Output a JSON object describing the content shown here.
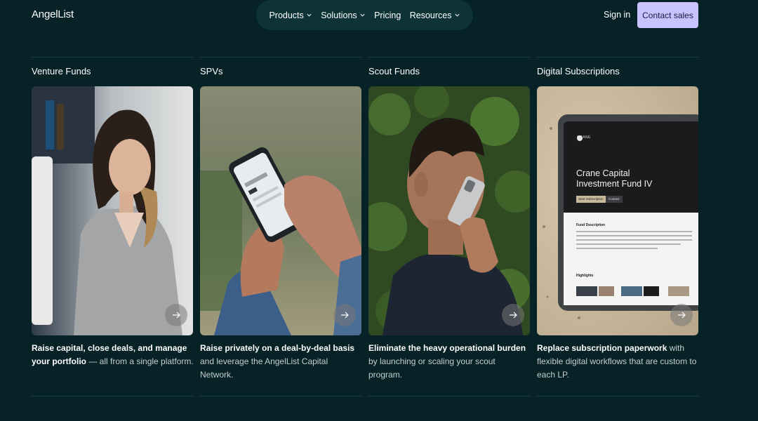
{
  "header": {
    "logo": "AngelList",
    "nav": [
      {
        "label": "Products",
        "has_dropdown": true
      },
      {
        "label": "Solutions",
        "has_dropdown": true
      },
      {
        "label": "Pricing",
        "has_dropdown": false
      },
      {
        "label": "Resources",
        "has_dropdown": true
      }
    ],
    "signin_label": "Sign in",
    "contact_label": "Contact sales"
  },
  "colors": {
    "background": "#062226",
    "nav_pill": "#0d3337",
    "contact_button": "#c8c3ff",
    "divider": "#1e4145"
  },
  "columns": [
    {
      "title": "Venture Funds",
      "desc_bold_1": "Raise capital, close deals, and manage your portfolio",
      "desc_rest": " — all from a single platform.",
      "arrow_icon": "arrow-right-icon"
    },
    {
      "title": "SPVs",
      "desc_bold_1": "Raise privately on a deal-by-deal basis",
      "desc_rest": " and leverage the AngelList Capital Network.",
      "arrow_icon": "arrow-right-icon"
    },
    {
      "title": "Scout Funds",
      "desc_bold_1": "Eliminate the heavy operational burden",
      "desc_rest": " by launching or scaling your scout program.",
      "arrow_icon": "arrow-right-icon"
    },
    {
      "title": "Digital Subscriptions",
      "desc_bold_1": "Replace subscription paperwork",
      "desc_rest": " with flexible digital workflows that are custom to each LP.",
      "arrow_icon": "arrow-right-icon"
    }
  ],
  "tablet_screen": {
    "brand": "CRANE",
    "fund_name_1": "Crane Capital",
    "fund_name_2": "Investment Fund IV",
    "primary_btn": "Start Subscription",
    "secondary_btn": "Contact",
    "section_1": "Fund Description",
    "section_2": "Highlights"
  }
}
